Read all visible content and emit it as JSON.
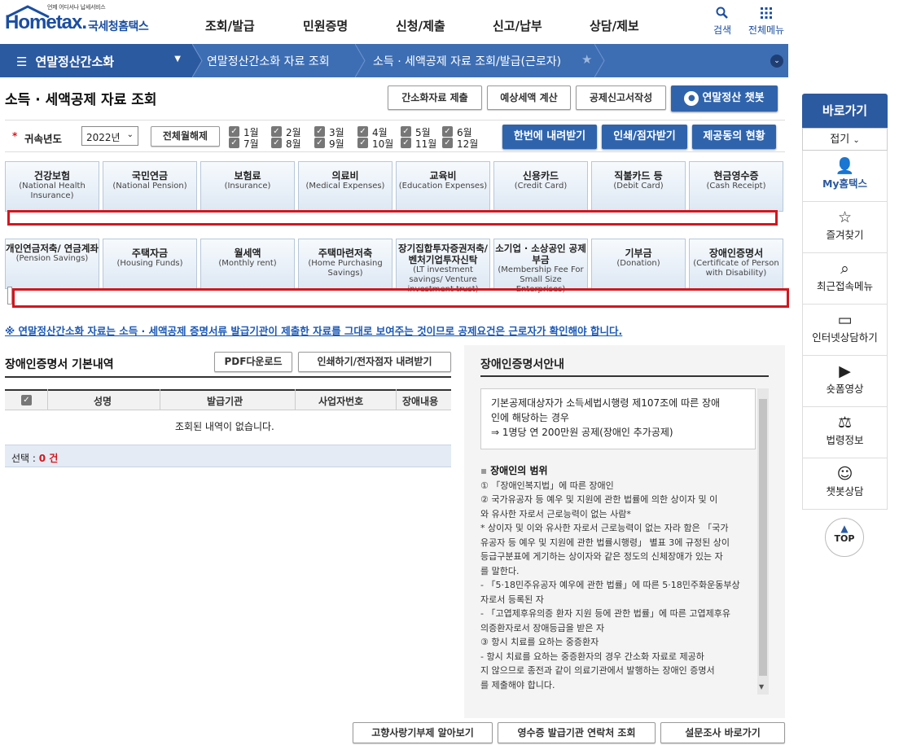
{
  "header": {
    "logo_tag": "언제 어디서나 납세서비스",
    "logo_word_a": "Home",
    "logo_word_b": "tax.",
    "logo_kr": "국세청홈택스",
    "gnb": [
      "조회/발급",
      "민원증명",
      "신청/제출",
      "신고/납부",
      "상담/제보"
    ],
    "search_label": "검색",
    "menu_label": "전체메뉴"
  },
  "nav": {
    "current": "연말정산간소화",
    "crumbs": [
      "연말정산간소화 자료 조회",
      "소득 · 세액공제 자료 조회/발급(근로자)"
    ]
  },
  "page": {
    "title": "소득 · 세액공제 자료 조회",
    "top_buttons": [
      "간소화자료 제출",
      "예상세액 계산",
      "공제신고서작성"
    ],
    "chatbot_button": "연말정산 챗봇"
  },
  "year_row": {
    "required_mark": "*",
    "label": "귀속년도",
    "year_value": "2022년",
    "clear_all": "전체월해제",
    "months_top": [
      "1월",
      "2월",
      "3월",
      "4월",
      "5월",
      "6월"
    ],
    "months_bottom": [
      "7월",
      "8월",
      "9월",
      "10월",
      "11월",
      "12월"
    ],
    "actions": [
      "한번에 내려받기",
      "인쇄/점자받기",
      "제공동의 현황"
    ]
  },
  "tabs_row1": [
    {
      "kr": "건강보험",
      "en": "(National Health Insurance)"
    },
    {
      "kr": "국민연금",
      "en": "(National Pension)"
    },
    {
      "kr": "보험료",
      "en": "(Insurance)"
    },
    {
      "kr": "의료비",
      "en": "(Medical Expenses)"
    },
    {
      "kr": "교육비",
      "en": "(Education Expenses)"
    },
    {
      "kr": "신용카드",
      "en": "(Credit Card)"
    },
    {
      "kr": "직불카드 등",
      "en": "(Debit Card)"
    },
    {
      "kr": "현금영수증",
      "en": "(Cash Receipt)"
    }
  ],
  "tabs_row2": [
    {
      "kr": "개인연금저축/ 연금계좌",
      "en": "(Pension Savings)"
    },
    {
      "kr": "주택자금",
      "en": "(Housing Funds)"
    },
    {
      "kr": "월세액",
      "en": "(Monthly rent)"
    },
    {
      "kr": "주택마련저축",
      "en": "(Home Purchasing Savings)"
    },
    {
      "kr": "장기집합투자증권저축/ 벤처기업투자신탁",
      "en": "(LT investment savings/ Venture investment trust)"
    },
    {
      "kr": "소기업 · 소상공인 공제부금",
      "en": "(Membership Fee For Small Size Enterprises)"
    },
    {
      "kr": "기부금",
      "en": "(Donation)"
    },
    {
      "kr": "장애인증명서",
      "en": "(Certificate of Person with Disability)"
    }
  ],
  "notice": "※ 연말정산간소화 자료는 소득 · 세액공제 증명서류 발급기관이 제출한 자료를 그대로 보여주는 것이므로 공제요건은 근로자가 확인해야 합니다.",
  "left": {
    "title": "장애인증명서 기본내역",
    "pdf_button": "PDF다운로드",
    "print_button": "인쇄하기/전자점자 내려받기",
    "columns": [
      "성명",
      "발급기관",
      "사업자번호",
      "장애내용"
    ],
    "empty": "조회된 내역이 없습니다.",
    "select_label": "선택 :",
    "select_count": "0 건"
  },
  "guide": {
    "title": "장애인증명서안내",
    "box": [
      "기본공제대상자가 소득세법시행령 제107조에 따른 장애",
      "인에 해당하는 경우",
      "⇒ 1명당 연 200만원 공제(장애인 추가공제)"
    ],
    "section_title": "장애인의 범위",
    "lines": [
      "① 「장애인복지법」에 따른 장애인",
      "② 국가유공자 등 예우 및 지원에 관한 법률에 의한 상이자 및 이",
      "와 유사한 자로서 근로능력이 없는 사람*",
      "* 상이자 및 이와 유사한 자로서 근로능력이 없는 자라 함은 「국가",
      "유공자 등 예우 및 지원에 관한 법률시행령」 별표 3에 규정된 상이",
      "등급구분표에 게기하는 상이자와 같은 정도의 신체장애가 있는 자",
      "를 말한다.",
      "- 「5·18민주유공자 예우에 관한 법률」에 따른 5·18민주화운동부상",
      "자로서 등록된 자",
      "- 「고엽제후유의증 환자 지원 등에 관한 법률」에 따른 고엽제후유",
      "의증환자로서 장애등급을 받은 자",
      "③ 항시 치료를 요하는 중증환자",
      "- 항시 치료를 요하는 중증환자의 경우 간소화 자료로 제공하",
      "지 않으므로 종전과 같이 의료기관에서 발행하는 장애인 증명서",
      "를 제출해야 합니다."
    ]
  },
  "bottom_buttons": [
    "고향사랑기부제 알아보기",
    "영수증 발급기관 연락처 조회",
    "설문조사 바로가기"
  ],
  "sidebar": {
    "title": "바로가기",
    "fold": "접기",
    "items": [
      {
        "label": "My홈택스",
        "icon": "person-icon"
      },
      {
        "label": "즐겨찾기",
        "icon": "star-icon"
      },
      {
        "label": "최근접속메뉴",
        "icon": "recent-menu-icon"
      },
      {
        "label": "인터넷상담하기",
        "icon": "laptop-icon"
      },
      {
        "label": "숏폼영상",
        "icon": "play-icon"
      },
      {
        "label": "법령정보",
        "icon": "gavel-icon"
      },
      {
        "label": "챗봇상담",
        "icon": "chatbot-icon"
      }
    ],
    "top": "TOP"
  },
  "colors": {
    "brand": "#1a4ea1",
    "nav": "#3d6eb4",
    "accent_button": "#2f64ad",
    "highlight_box": "#d4161d",
    "notice": "#1a58b5"
  }
}
